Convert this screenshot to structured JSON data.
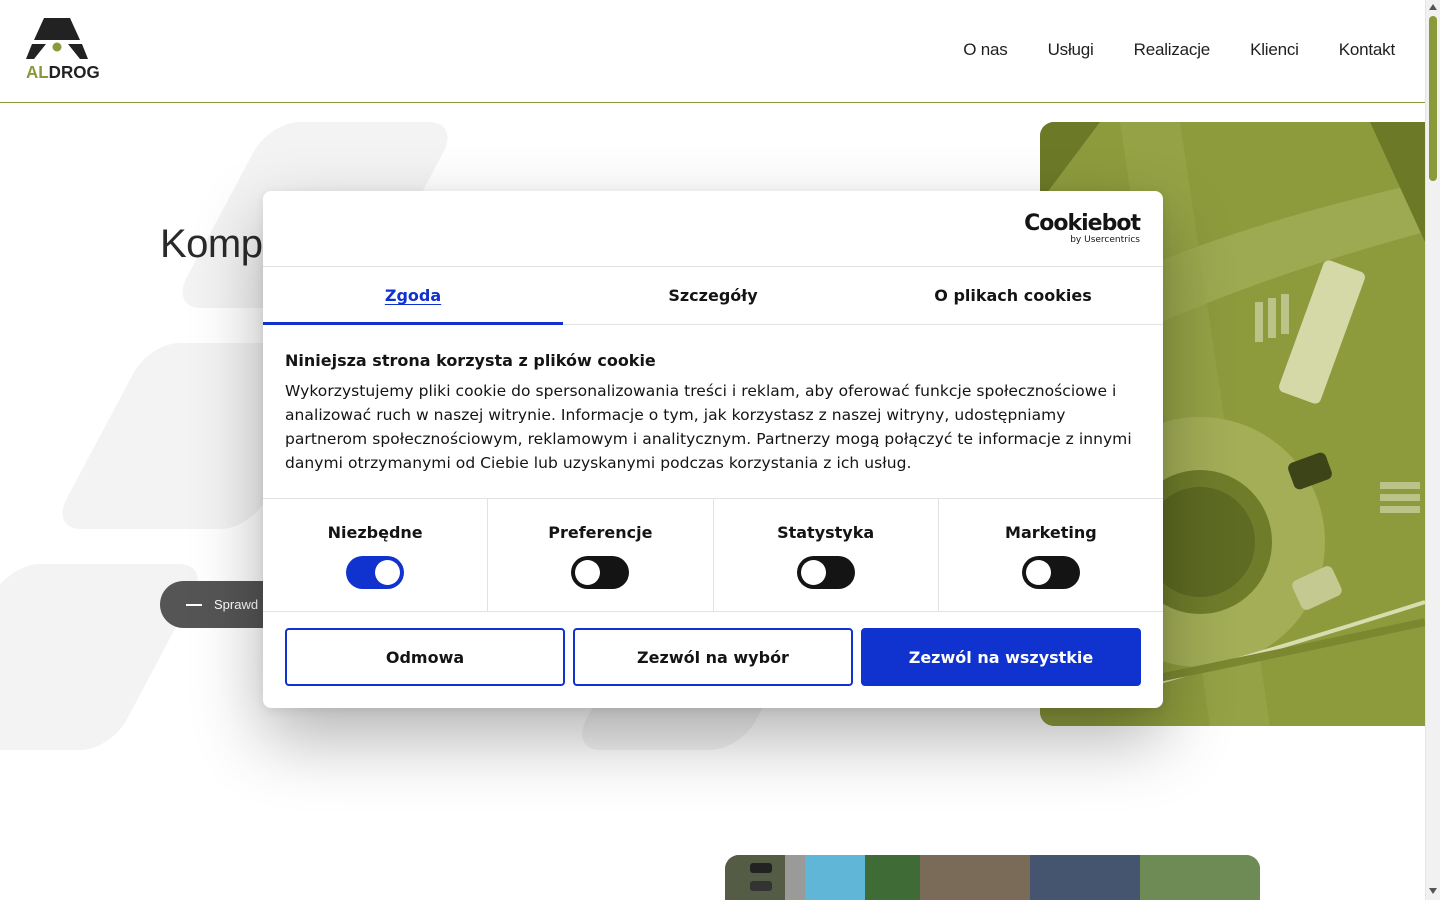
{
  "header": {
    "logo_text_accent": "AL",
    "logo_text_rest": "DROG",
    "nav": [
      "O nas",
      "Usługi",
      "Realizacje",
      "Klienci",
      "Kontakt"
    ]
  },
  "hero": {
    "title_visible": "Komp",
    "button_visible": "Sprawd"
  },
  "cookie_dialog": {
    "brand": "Cookiebot",
    "brand_sub": "by Usercentrics",
    "tabs": [
      "Zgoda",
      "Szczegóły",
      "O plikach cookies"
    ],
    "active_tab": "Zgoda",
    "heading": "Niniejsza strona korzysta z plików cookie",
    "description": "Wykorzystujemy pliki cookie do spersonalizowania treści i reklam, aby oferować funkcje społecznościowe i analizować ruch w naszej witrynie. Informacje o tym, jak korzystasz z naszej witryny, udostępniamy partnerom społecznościowym, reklamowym i analitycznym. Partnerzy mogą połączyć te informacje z innymi danymi otrzymanymi od Ciebie lub uzyskanymi podczas korzystania z ich usług.",
    "toggles": [
      {
        "label": "Niezbędne",
        "on": true
      },
      {
        "label": "Preferencje",
        "on": false
      },
      {
        "label": "Statystyka",
        "on": false
      },
      {
        "label": "Marketing",
        "on": false
      }
    ],
    "buttons": {
      "decline": "Odmowa",
      "allow_selection": "Zezwól na wybór",
      "allow_all": "Zezwól na wszystkie"
    }
  },
  "colors": {
    "accent_olive": "#8a9a3a",
    "cookiebot_blue": "#1032cf",
    "text_dark": "#141414"
  }
}
